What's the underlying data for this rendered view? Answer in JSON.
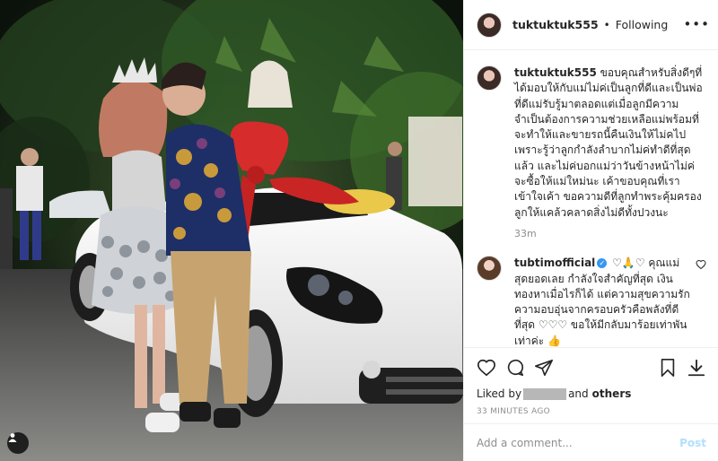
{
  "header": {
    "username": "tuktuktuk555",
    "separator": "•",
    "follow_status": "Following",
    "more_icon": "more-options-icon"
  },
  "caption": {
    "username": "tuktuktuk555",
    "text": "ขอบคุณสำหรับสิ่งดีๆที่ได้มอบให้กับแม่ไม่ค่เป็นลูกที่ดีและเป็นพ่อที่ดีแม่รับรู้มาตลอดแต่เมื่อลูกมีความจำเป็นต้องการความช่วยเหลือแม่พร้อมที่จะทำให้และขายรถนี้คืนเงินให้ไม่คไปเพราะรู้ว่าลูกกำลังลำบากไม่ค่ทำดีที่สุดแล้ว และไม่ค่บอกแม่ว่าวันข้างหน้าไม่ค่จะซื้อให้แม่ใหม่นะ เค้าขอบคุณที่เราเข้าใจเค้า ขอความดีที่ลูกทำพระคุ้มครองลูกให้แคล้วคลาดสิ่งไม่ดีทั้งปวงนะ",
    "time": "33m"
  },
  "comment": {
    "username": "tubtimofficial",
    "verified_icon": "verified-badge-icon",
    "text": "♡🙏♡ คุณแม่สุดยอดเลย กำลังใจสำคัญที่สุด เงินทองหาเมื่อไรก็ได้ แต่ความสุขความรักความอบอุ่นจากครอบครัวคือพลังที่ดีที่สุด ♡♡♡ ขอให้มีกลับมาร้อยเท่าพันเท่าค่ะ 👍",
    "like_icon": "heart-outline-icon"
  },
  "actions": {
    "icons": [
      "heart-icon",
      "comment-icon",
      "share-icon",
      "bookmark-icon",
      "download-icon"
    ],
    "liked_prefix": "Liked by",
    "liked_and": "and",
    "liked_others": "others",
    "time_ago": "33 MINUTES AGO"
  },
  "add_comment": {
    "placeholder": "Add a comment...",
    "post_label": "Post"
  },
  "colors": {
    "accent": "#3897f0",
    "post_disabled": "#b2dffc",
    "muted": "#8e8e8e",
    "text": "#262626",
    "ribbon": "#d62c2c"
  }
}
